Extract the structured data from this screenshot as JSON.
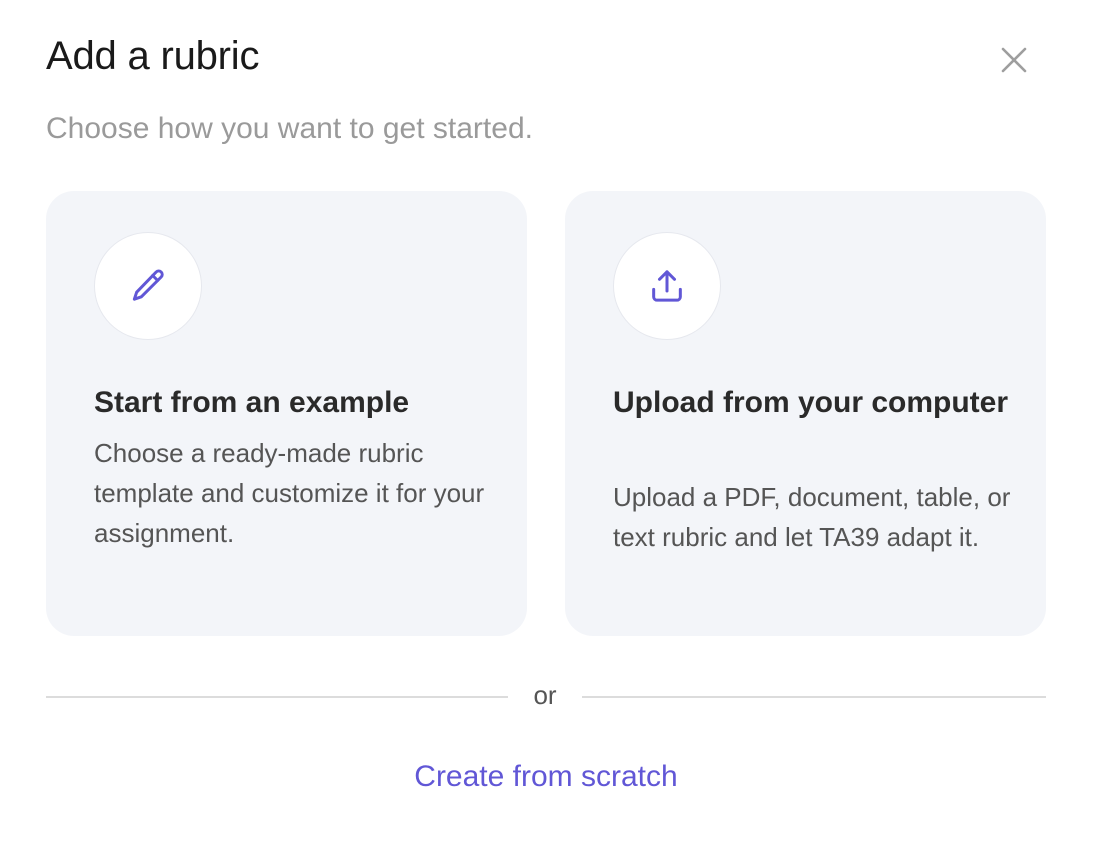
{
  "dialog": {
    "title": "Add a rubric",
    "subtitle": "Choose how you want to get started."
  },
  "cards": {
    "example": {
      "icon": "pencil-icon",
      "title": "Start from an example",
      "description": "Choose a ready-made rubric template and customize it for your assignment."
    },
    "upload": {
      "icon": "upload-icon",
      "title": "Upload from your computer",
      "description": "Upload a PDF, document, table, or text rubric and let TA39 adapt it."
    }
  },
  "divider": {
    "text": "or"
  },
  "scratch": {
    "label": "Create from scratch"
  },
  "colors": {
    "accent": "#6157d6",
    "card_bg": "#f3f5f9",
    "subtitle": "#9a9a9a",
    "close_icon": "#9e9e9e"
  }
}
